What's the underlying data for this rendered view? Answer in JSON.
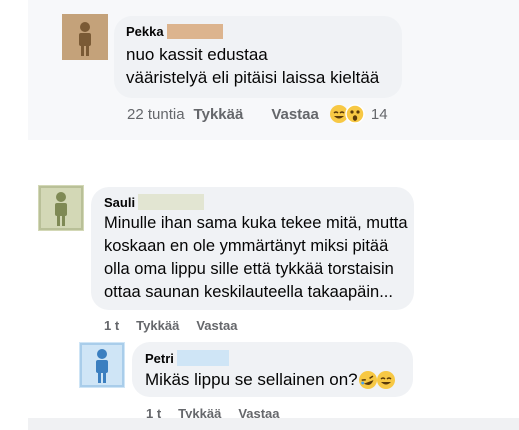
{
  "comments": [
    {
      "author": "Pekka",
      "avatar_color": "#9c7a4f",
      "redact_color": "#dcb48e",
      "text_lines": [
        "nuo kassit edustaa",
        "vääristelyä eli pitäisi laissa kieltää"
      ],
      "time": "22 tuntia",
      "like_label": "Tykkää",
      "reply_label": "Vastaa",
      "reaction_count": "14",
      "reactions": [
        "grin-sweat-emoji",
        "surprised-emoji"
      ]
    },
    {
      "author": "Sauli",
      "avatar_color": "#8f9a6e",
      "redact_color": "#d9dec3",
      "text_lines": [
        "Minulle ihan sama kuka tekee mitä, mutta",
        "koskaan en ole ymmärtänyt miksi pitää",
        "olla oma lippu sille että tykkää torstaisin",
        "ottaa saunan keskilauteella takaapäin..."
      ],
      "time": "1 t",
      "like_label": "Tykkää",
      "reply_label": "Vastaa"
    },
    {
      "author": "Petri",
      "avatar_color": "#7aaedb",
      "redact_color": "#cfe5f6",
      "text_lines": [
        "Mikäs lippu se sellainen on? "
      ],
      "time": "1 t",
      "like_label": "Tykkää",
      "reply_label": "Vastaa",
      "reactions": [
        "rolling-laughing-emoji",
        "grin-sweat-emoji"
      ]
    }
  ],
  "colors": {
    "bubble": "#f0f2f5",
    "meta_text": "#65676b",
    "emoji_yellow": "#f7c844"
  }
}
